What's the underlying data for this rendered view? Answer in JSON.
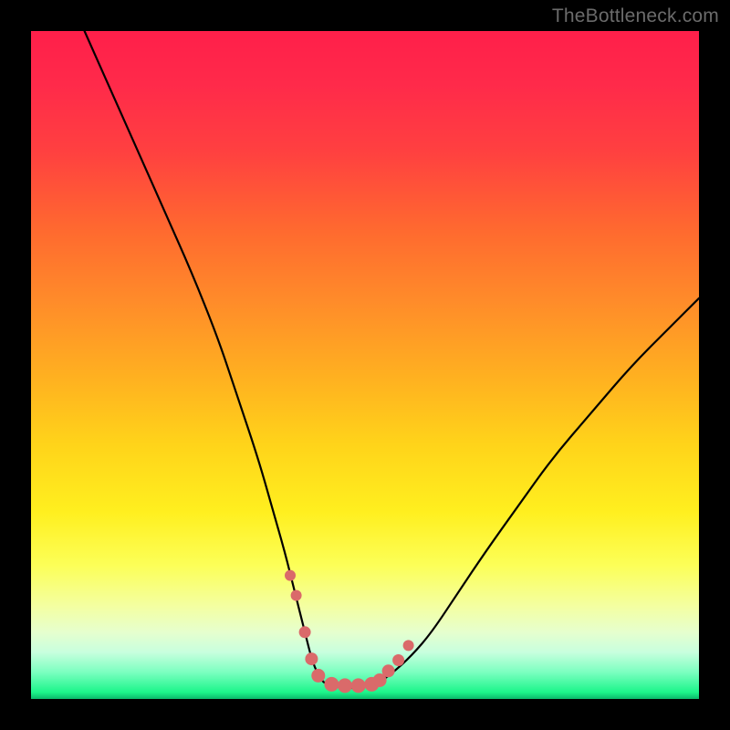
{
  "watermark": "TheBottleneck.com",
  "chart_data": {
    "type": "line",
    "title": "",
    "xlabel": "",
    "ylabel": "",
    "xlim": [
      0,
      100
    ],
    "ylim": [
      0,
      100
    ],
    "series": [
      {
        "name": "curve",
        "x": [
          8,
          12,
          16,
          20,
          24,
          28,
          31,
          34,
          36,
          38,
          39.5,
          41,
          42,
          43,
          44,
          46,
          48,
          50,
          52,
          54,
          57,
          60,
          64,
          68,
          73,
          78,
          84,
          90,
          96,
          100
        ],
        "y": [
          100,
          91,
          82,
          73,
          64,
          54,
          45,
          36,
          29,
          22,
          16,
          10,
          6,
          3.5,
          2.2,
          1.8,
          1.6,
          1.8,
          2.4,
          3.8,
          6.5,
          10,
          16,
          22,
          29,
          36,
          43,
          50,
          56,
          60
        ]
      }
    ],
    "markers": {
      "name": "highlight-points",
      "x": [
        38.8,
        39.7,
        41.0,
        42.0,
        43.0,
        45.0,
        47.0,
        49.0,
        51.0,
        52.2,
        53.5,
        55.0,
        56.5
      ],
      "y": [
        18.5,
        15.5,
        10.0,
        6.0,
        3.5,
        2.2,
        2.0,
        2.0,
        2.2,
        2.8,
        4.2,
        5.8,
        8.0
      ],
      "r": [
        6,
        6,
        6.5,
        7,
        7.5,
        8,
        8,
        8,
        8,
        7.5,
        7,
        6.5,
        6
      ]
    },
    "colors": {
      "curve": "#000000",
      "markers": "#da6a6a",
      "gradient_top": "#ff1f4a",
      "gradient_bottom": "#0bb86a"
    }
  }
}
